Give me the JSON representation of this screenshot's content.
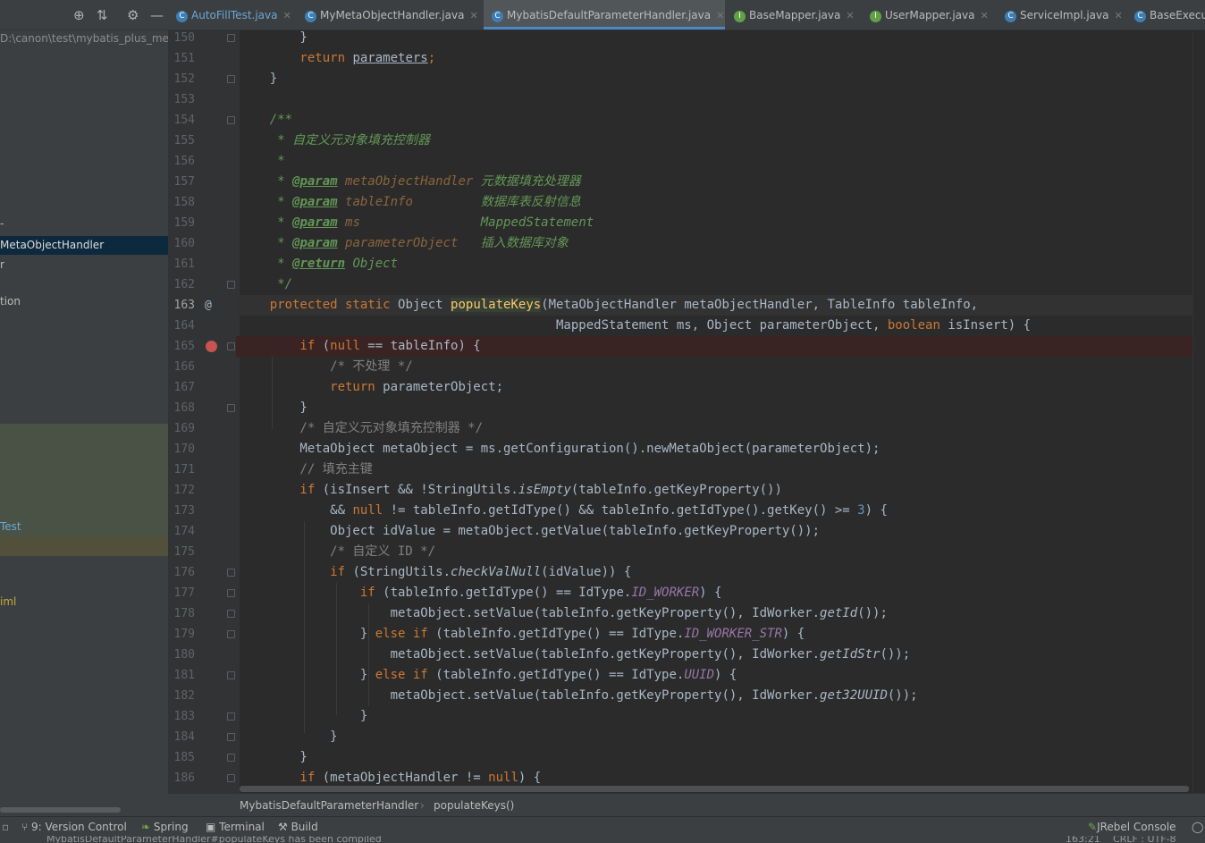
{
  "sidebar": {
    "path": "D:\\canon\\test\\mybatis_plus_meta",
    "items": [
      "-",
      "MetaObjectHandler",
      "r",
      "tion",
      "Test",
      "iml"
    ]
  },
  "tabs": [
    {
      "label": "AutoFillTest.java",
      "icon": "class-icon"
    },
    {
      "label": "MyMetaObjectHandler.java",
      "icon": "class-icon"
    },
    {
      "label": "MybatisDefaultParameterHandler.java",
      "icon": "class-icon"
    },
    {
      "label": "BaseMapper.java",
      "icon": "interface-icon"
    },
    {
      "label": "UserMapper.java",
      "icon": "interface-icon"
    },
    {
      "label": "ServiceImpl.java",
      "icon": "class-icon"
    },
    {
      "label": "BaseExecut",
      "icon": "class-icon"
    }
  ],
  "line_numbers": [
    "150",
    "151",
    "152",
    "153",
    "154",
    "155",
    "156",
    "157",
    "158",
    "159",
    "160",
    "161",
    "162",
    "163",
    "164",
    "165",
    "166",
    "167",
    "168",
    "169",
    "170",
    "171",
    "172",
    "173",
    "174",
    "175",
    "176",
    "177",
    "178",
    "179",
    "180",
    "181",
    "182",
    "183",
    "184",
    "185",
    "186"
  ],
  "code": {
    "l150": "        }",
    "l151a": "        return ",
    "l151b": "parameters",
    "l151c": ";",
    "l152": "    }",
    "l154": "    /**",
    "l155": "     * 自定义元对象填充控制器",
    "l156": "     *",
    "l157a": "     * ",
    "l157tag": "@param",
    "l157p": " metaObjectHandler",
    "l157d": " 元数据填充处理器",
    "l158a": "     * ",
    "l158tag": "@param",
    "l158p": " tableInfo",
    "l158d": "         数据库表反射信息",
    "l159a": "     * ",
    "l159tag": "@param",
    "l159p": " ms",
    "l159d": "                MappedStatement",
    "l160a": "     * ",
    "l160tag": "@param",
    "l160p": " parameterObject",
    "l160d": "   插入数据库对象",
    "l161a": "     * ",
    "l161tag": "@return",
    "l161d": " Object",
    "l162": "     */",
    "l163k": "    protected static ",
    "l163t": "Object ",
    "l163f": "populateKeys",
    "l163r": "(MetaObjectHandler metaObjectHandler, TableInfo tableInfo,",
    "l164a": "                                          MappedStatement ms, Object parameterObject, ",
    "l164k": "boolean",
    "l164b": " isInsert) {",
    "l165k": "        if ",
    "l165a": "(",
    "l165n": "null",
    "l165b": " == tableInfo) {",
    "l166": "            /* 不处理 */",
    "l167k": "            return ",
    "l167a": "parameterObject;",
    "l168": "        }",
    "l169": "        /* 自定义元对象填充控制器 */",
    "l170": "        MetaObject metaObject = ms.getConfiguration().newMetaObject(parameterObject);",
    "l171": "        // 填充主键",
    "l172k": "        if ",
    "l172a": "(isInsert && !StringUtils.",
    "l172i": "isEmpty",
    "l172b": "(tableInfo.getKeyProperty())",
    "l173a": "            && ",
    "l173n": "null",
    "l173b": " != tableInfo.getIdType() && tableInfo.getIdType().getKey() >= ",
    "l173num": "3",
    "l173c": ") {",
    "l174": "            Object idValue = metaObject.getValue(tableInfo.getKeyProperty());",
    "l175": "            /* 自定义 ID */",
    "l176k": "            if ",
    "l176a": "(StringUtils.",
    "l176i": "checkValNull",
    "l176b": "(idValue)) {",
    "l177k": "                if ",
    "l177a": "(tableInfo.getIdType() == IdType.",
    "l177s": "ID_WORKER",
    "l177b": ") {",
    "l178a": "                    metaObject.setValue(tableInfo.getKeyProperty(), IdWorker.",
    "l178i": "getId",
    "l178b": "());",
    "l179a": "                } ",
    "l179k": "else if ",
    "l179b": "(tableInfo.getIdType() == IdType.",
    "l179s": "ID_WORKER_STR",
    "l179c": ") {",
    "l180a": "                    metaObject.setValue(tableInfo.getKeyProperty(), IdWorker.",
    "l180i": "getIdStr",
    "l180b": "());",
    "l181a": "                } ",
    "l181k": "else if ",
    "l181b": "(tableInfo.getIdType() == IdType.",
    "l181s": "UUID",
    "l181c": ") {",
    "l182a": "                    metaObject.setValue(tableInfo.getKeyProperty(), IdWorker.",
    "l182i": "get32UUID",
    "l182b": "());",
    "l183": "                }",
    "l184": "            }",
    "l185": "        }",
    "l186k": "        if ",
    "l186a": "(metaObjectHandler != ",
    "l186n": "null",
    "l186b": ") {"
  },
  "breadcrumb": {
    "class": "MybatisDefaultParameterHandler",
    "method": "populateKeys()"
  },
  "toolwindows": {
    "version_control": "9: Version Control",
    "spring": "Spring",
    "terminal": "Terminal",
    "build": "Build",
    "jrebel": "JRebel Console"
  },
  "status": {
    "text": "MybatisDefaultParameterHandler#populateKeys has been compiled",
    "position": "163:21",
    "encoding": "CRLF : UTF-8"
  }
}
